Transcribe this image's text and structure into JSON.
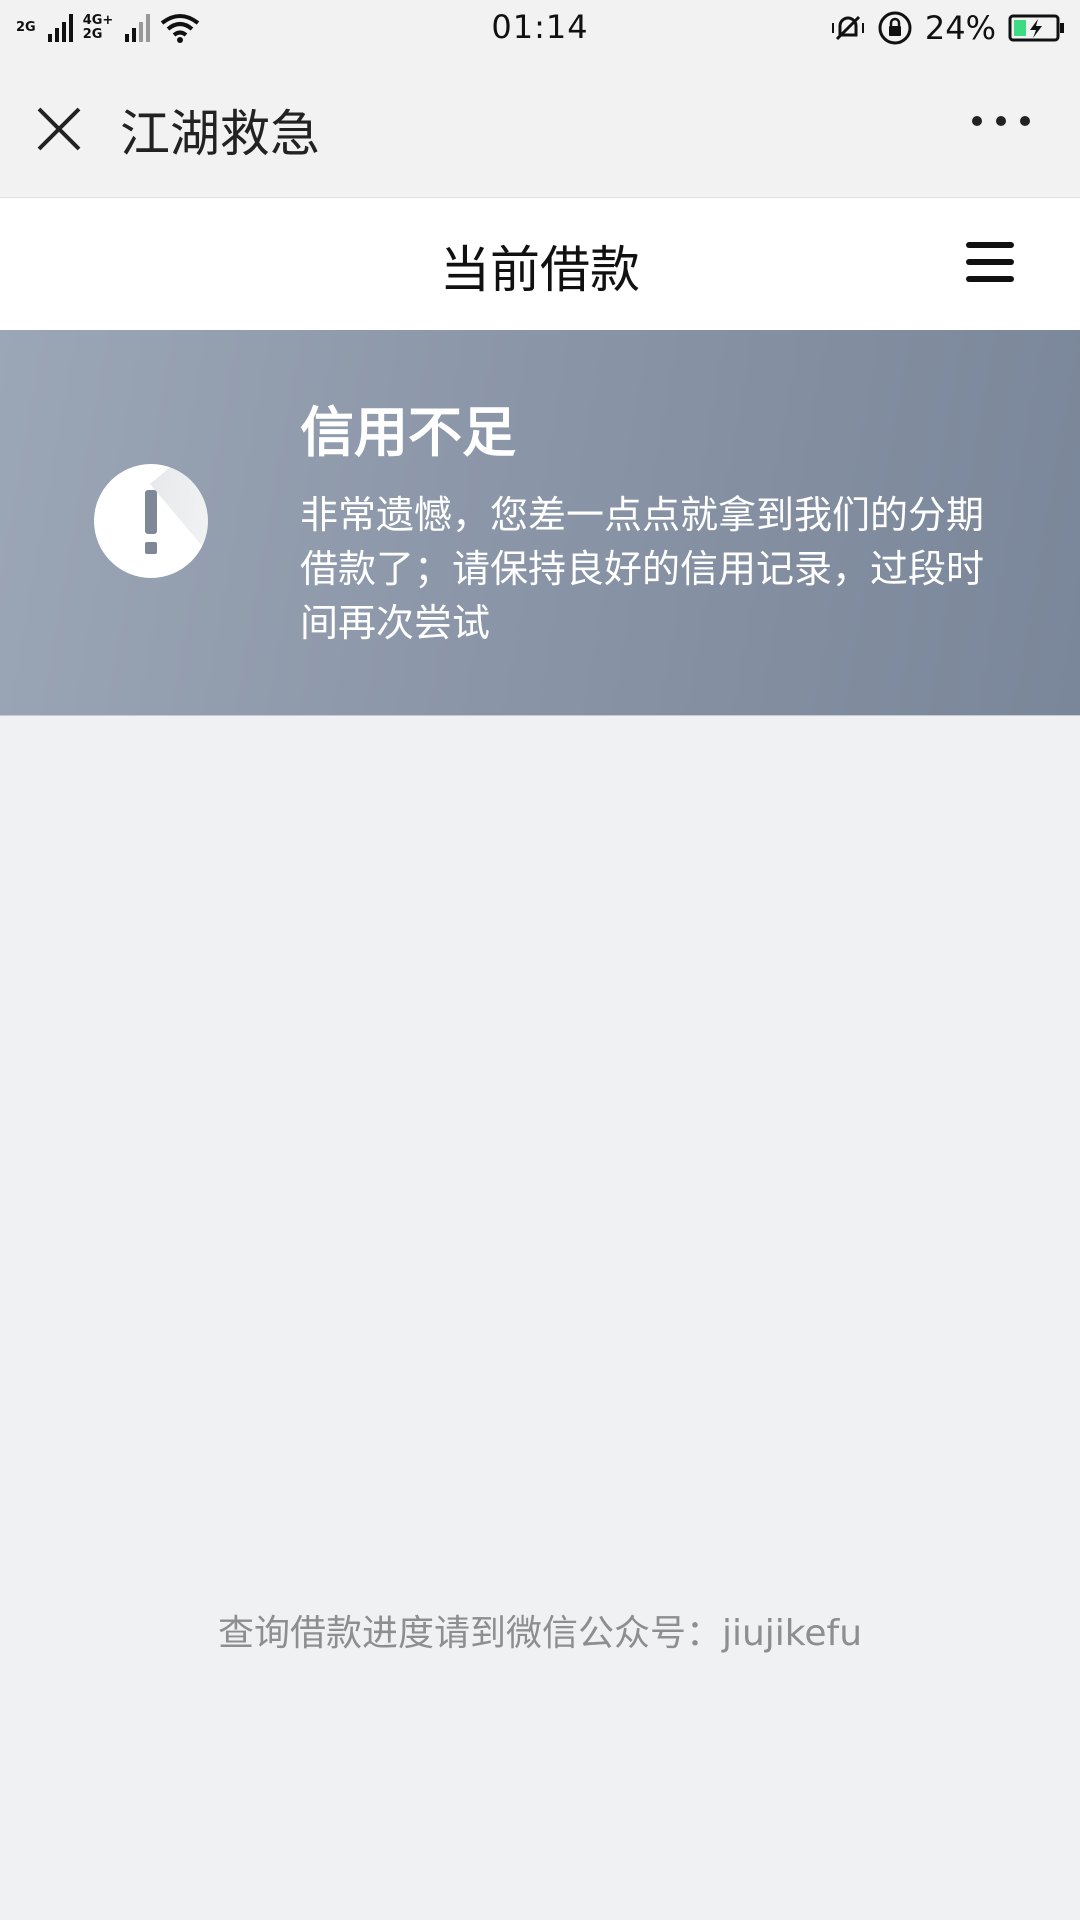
{
  "status_bar": {
    "net_top": "2G",
    "net_mid_top": "4G+",
    "net_mid_bottom": "2G",
    "time": "01:14",
    "battery": "24%",
    "icons": [
      "signal-icon",
      "wifi-icon",
      "mute-icon",
      "rotation-lock-icon",
      "battery-icon"
    ]
  },
  "nav": {
    "title": "江湖救急",
    "close_icon": "close-icon",
    "more_icon": "more-icon"
  },
  "header": {
    "title": "当前借款",
    "menu_icon": "hamburger-menu-icon"
  },
  "banner": {
    "icon": "alert-icon",
    "title": "信用不足",
    "description": "非常遗憾，您差一点点就拿到我们的分期借款了；请保持良好的信用记录，过段时间再次尝试"
  },
  "footer": {
    "note": "查询借款进度请到微信公众号：jiujikefu"
  },
  "colors": {
    "banner_start": "#9ba6b6",
    "banner_end": "#7a8699",
    "background": "#f0f1f3",
    "footer_text": "#8e8e8e"
  }
}
